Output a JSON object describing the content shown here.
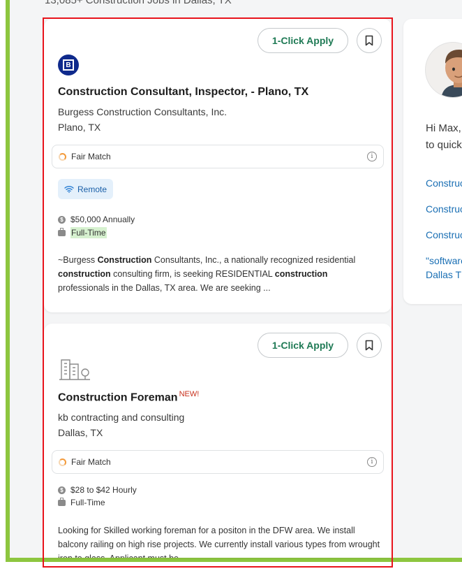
{
  "header": {
    "jobs_count": "13,085+ Construction Jobs in Dallas, TX"
  },
  "jobs": [
    {
      "apply_label": "1-Click Apply",
      "title": "Construction Consultant, Inspector, - Plano, TX",
      "company": "Burgess Construction Consultants, Inc.",
      "location": "Plano, TX",
      "match_label": "Fair Match",
      "remote_label": "Remote",
      "salary": "$50,000 Annually",
      "job_type": "Full-Time",
      "snippet": [
        {
          "t": "~Burgess "
        },
        {
          "t": "Construction",
          "b": true
        },
        {
          "t": " Consultants, Inc., a nationally recognized residential "
        },
        {
          "t": "construction",
          "b": true
        },
        {
          "t": " consulting firm, is seeking RESIDENTIAL "
        },
        {
          "t": "construction",
          "b": true
        },
        {
          "t": " professionals in the Dallas, TX area. We are seeking ..."
        }
      ]
    },
    {
      "apply_label": "1-Click Apply",
      "title": "Construction Foreman",
      "new_badge": "NEW!",
      "company": "kb contracting and consulting",
      "location": "Dallas, TX",
      "match_label": "Fair Match",
      "salary": "$28 to $42 Hourly",
      "job_type": "Full-Time",
      "snippet": [
        {
          "t": "Looking for Skilled working foreman for a positon in the DFW area. We install balcony railing on high rise projects. We currently install various types from wrought iron to glass. Applicant must be ..."
        }
      ]
    }
  ],
  "sidebar": {
    "greeting_line1": "Hi Max,",
    "greeting_line2": "to quick",
    "links": [
      "Construc",
      "Construc",
      "Construc"
    ],
    "link_last_line1": "\"software",
    "link_last_line2": "Dallas T"
  },
  "colors": {
    "accent_green": "#8dc63f",
    "apply_text": "#1f7a55",
    "link_blue": "#1a6fb4",
    "outline_red": "#e8141c"
  },
  "icons": [
    "bookmark-icon",
    "company-logo",
    "building-icon",
    "match-icon",
    "info-icon",
    "wifi-icon",
    "dollar-icon",
    "briefcase-icon",
    "avatar"
  ]
}
